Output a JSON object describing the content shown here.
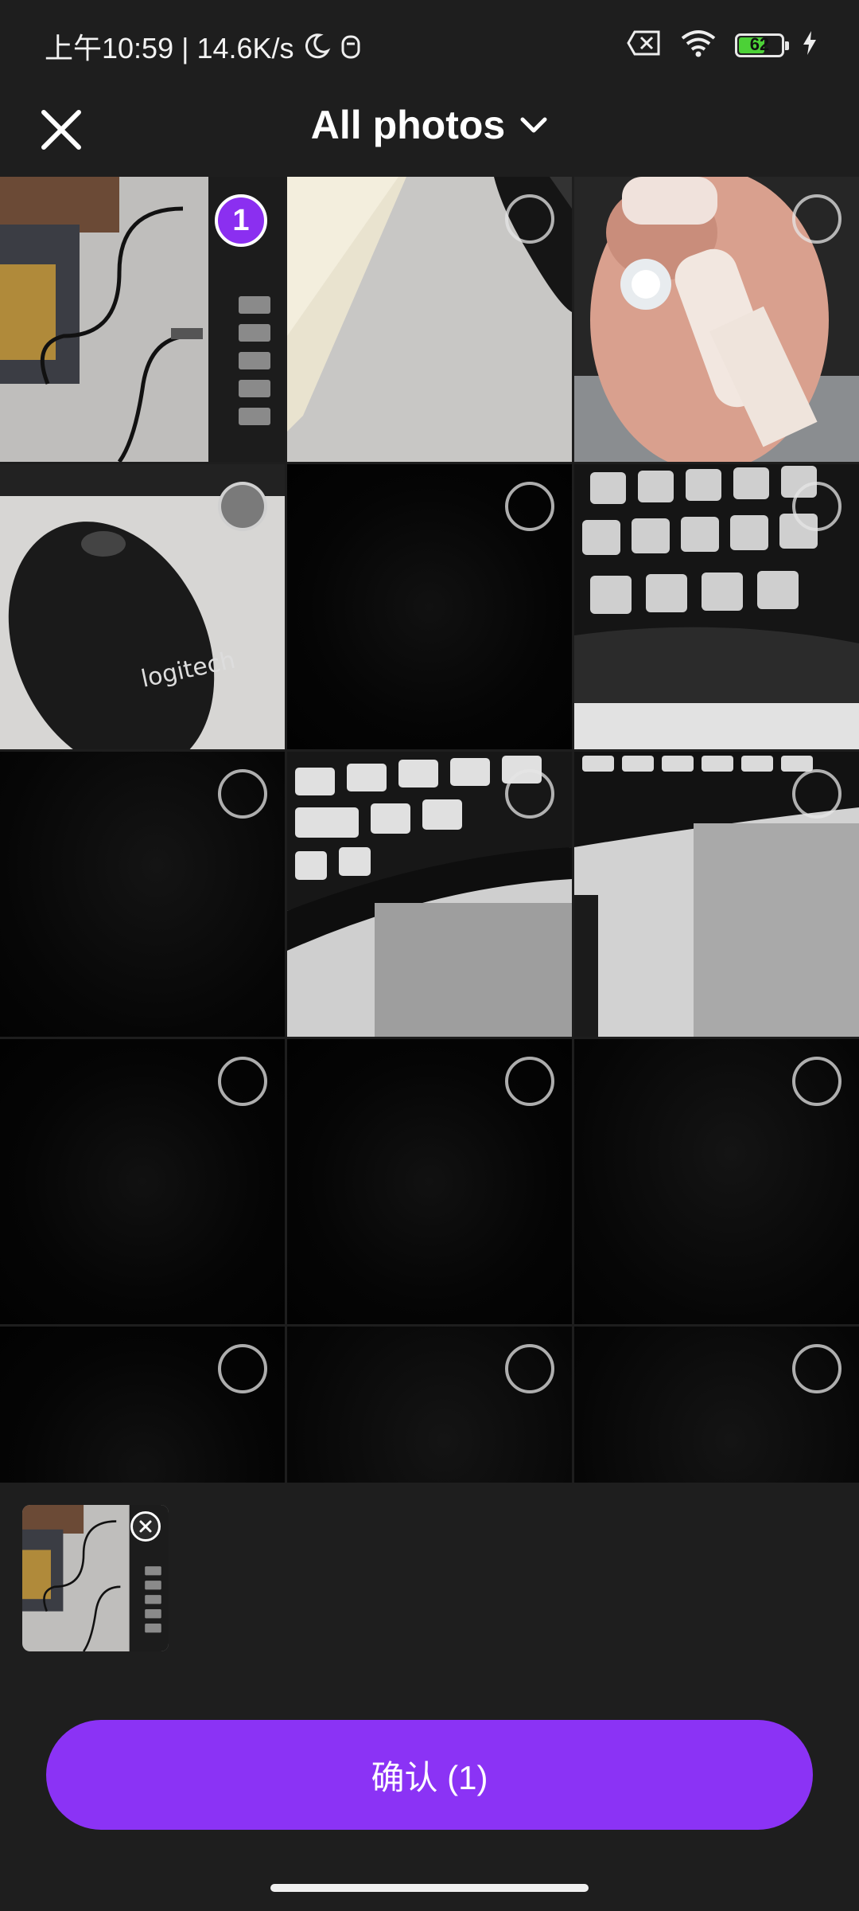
{
  "status_bar": {
    "time_text": "上午10:59 | 14.6K/s",
    "battery_level": "62",
    "battery_fraction": 0.62
  },
  "header": {
    "title": "All photos"
  },
  "grid": {
    "selected_badge": "1"
  },
  "preview": {
    "count": 1
  },
  "confirm": {
    "label": "确认 (1)"
  },
  "icons": [
    "close-icon",
    "chevron-down-icon",
    "moon-icon",
    "wifi-icon",
    "battery-icon",
    "charging-icon",
    "no-sim-icon"
  ],
  "colors": {
    "accent": "#8b33f5",
    "background": "#1e1e1e",
    "battery_fill": "#4cd137"
  }
}
